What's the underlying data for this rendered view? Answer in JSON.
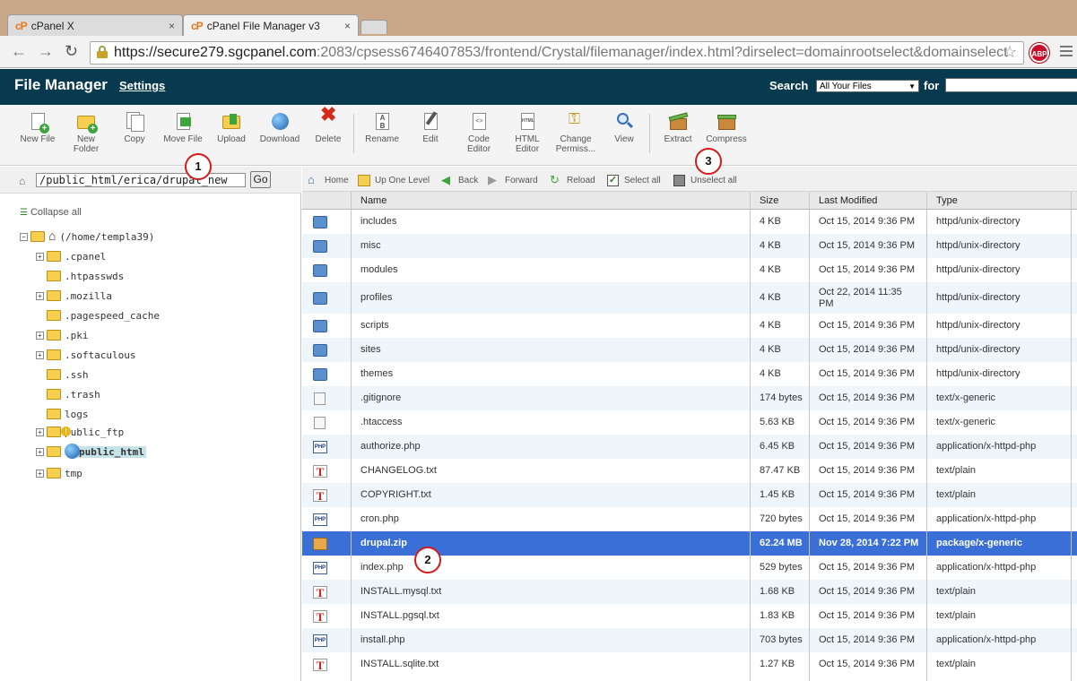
{
  "browser": {
    "tabs": [
      {
        "label": "cPanel X",
        "favicon": "cP",
        "active": false
      },
      {
        "label": "cPanel File Manager v3",
        "favicon": "cP",
        "active": true
      }
    ],
    "close_glyph": "×",
    "url_host": "https://secure279.sgcpanel.com",
    "url_rest": ":2083/cpsess6746407853/frontend/Crystal/filemanager/index.html?dirselect=domainrootselect&domainselect",
    "abp_label": "ABP"
  },
  "header": {
    "title": "File Manager",
    "settings_link": "Settings",
    "search_label": "Search",
    "search_scope": "All Your Files",
    "for_label": "for",
    "bg_color": "#083a4f"
  },
  "toolbar": {
    "new_file": "New File",
    "new_folder_1": "New",
    "new_folder_2": "Folder",
    "copy": "Copy",
    "move_file": "Move File",
    "upload": "Upload",
    "download": "Download",
    "delete": "Delete",
    "rename": "Rename",
    "edit": "Edit",
    "code_editor_1": "Code",
    "code_editor_2": "Editor",
    "html_editor_1": "HTML",
    "html_editor_2": "Editor",
    "change_perms_1": "Change",
    "change_perms_2": "Permiss...",
    "view": "View",
    "extract": "Extract",
    "compress": "Compress"
  },
  "callouts": [
    "1",
    "2",
    "3"
  ],
  "left": {
    "path_value": "/public_html/erica/drupal_new",
    "go_label": "Go",
    "collapse_all": "Collapse all",
    "root_label": "(/home/templa39)",
    "tree": [
      {
        "label": ".cpanel",
        "expandable": true
      },
      {
        "label": ".htpasswds",
        "expandable": false
      },
      {
        "label": ".mozilla",
        "expandable": true
      },
      {
        "label": ".pagespeed_cache",
        "expandable": false
      },
      {
        "label": ".pki",
        "expandable": true
      },
      {
        "label": ".softaculous",
        "expandable": true
      },
      {
        "label": ".ssh",
        "expandable": false
      },
      {
        "label": ".trash",
        "expandable": false
      },
      {
        "label": "logs",
        "expandable": false
      },
      {
        "label": "public_ftp",
        "expandable": true
      },
      {
        "label": "public_html",
        "expandable": true,
        "selected": true
      },
      {
        "label": "tmp",
        "expandable": true
      }
    ]
  },
  "nav": {
    "home": "Home",
    "up": "Up One Level",
    "back": "Back",
    "forward": "Forward",
    "reload": "Reload",
    "select_all": "Select all",
    "unselect_all": "Unselect all"
  },
  "table": {
    "columns": [
      "Name",
      "Size",
      "Last Modified",
      "Type"
    ],
    "rows": [
      {
        "icon": "folder",
        "name": "includes",
        "size": "4 KB",
        "modified": "Oct 15, 2014 9:36 PM",
        "type": "httpd/unix-directory"
      },
      {
        "icon": "folder",
        "name": "misc",
        "size": "4 KB",
        "modified": "Oct 15, 2014 9:36 PM",
        "type": "httpd/unix-directory"
      },
      {
        "icon": "folder",
        "name": "modules",
        "size": "4 KB",
        "modified": "Oct 15, 2014 9:36 PM",
        "type": "httpd/unix-directory"
      },
      {
        "icon": "folder",
        "name": "profiles",
        "size": "4 KB",
        "modified_1": "Oct 22, 2014 11:35",
        "modified_2": "PM",
        "type": "httpd/unix-directory"
      },
      {
        "icon": "folder",
        "name": "scripts",
        "size": "4 KB",
        "modified": "Oct 15, 2014 9:36 PM",
        "type": "httpd/unix-directory"
      },
      {
        "icon": "folder",
        "name": "sites",
        "size": "4 KB",
        "modified": "Oct 15, 2014 9:36 PM",
        "type": "httpd/unix-directory"
      },
      {
        "icon": "folder",
        "name": "themes",
        "size": "4 KB",
        "modified": "Oct 15, 2014 9:36 PM",
        "type": "httpd/unix-directory"
      },
      {
        "icon": "generic",
        "name": ".gitignore",
        "size": "174 bytes",
        "modified": "Oct 15, 2014 9:36 PM",
        "type": "text/x-generic"
      },
      {
        "icon": "generic",
        "name": ".htaccess",
        "size": "5.63 KB",
        "modified": "Oct 15, 2014 9:36 PM",
        "type": "text/x-generic"
      },
      {
        "icon": "php",
        "name": "authorize.php",
        "size": "6.45 KB",
        "modified": "Oct 15, 2014 9:36 PM",
        "type": "application/x-httpd-php"
      },
      {
        "icon": "text",
        "name": "CHANGELOG.txt",
        "size": "87.47 KB",
        "modified": "Oct 15, 2014 9:36 PM",
        "type": "text/plain"
      },
      {
        "icon": "text",
        "name": "COPYRIGHT.txt",
        "size": "1.45 KB",
        "modified": "Oct 15, 2014 9:36 PM",
        "type": "text/plain"
      },
      {
        "icon": "php",
        "name": "cron.php",
        "size": "720 bytes",
        "modified": "Oct 15, 2014 9:36 PM",
        "type": "application/x-httpd-php"
      },
      {
        "icon": "zip",
        "name": "drupal.zip",
        "size": "62.24 MB",
        "modified": "Nov 28, 2014 7:22 PM",
        "type": "package/x-generic",
        "selected": true
      },
      {
        "icon": "php",
        "name": "index.php",
        "size": "529 bytes",
        "modified": "Oct 15, 2014 9:36 PM",
        "type": "application/x-httpd-php"
      },
      {
        "icon": "text",
        "name": "INSTALL.mysql.txt",
        "size": "1.68 KB",
        "modified": "Oct 15, 2014 9:36 PM",
        "type": "text/plain"
      },
      {
        "icon": "text",
        "name": "INSTALL.pgsql.txt",
        "size": "1.83 KB",
        "modified": "Oct 15, 2014 9:36 PM",
        "type": "text/plain"
      },
      {
        "icon": "php",
        "name": "install.php",
        "size": "703 bytes",
        "modified": "Oct 15, 2014 9:36 PM",
        "type": "application/x-httpd-php"
      },
      {
        "icon": "text",
        "name": "INSTALL.sqlite.txt",
        "size": "1.27 KB",
        "modified": "Oct 15, 2014 9:36 PM",
        "type": "text/plain"
      }
    ]
  },
  "icon_glyphs": {
    "php": "PHP",
    "text": "T"
  }
}
